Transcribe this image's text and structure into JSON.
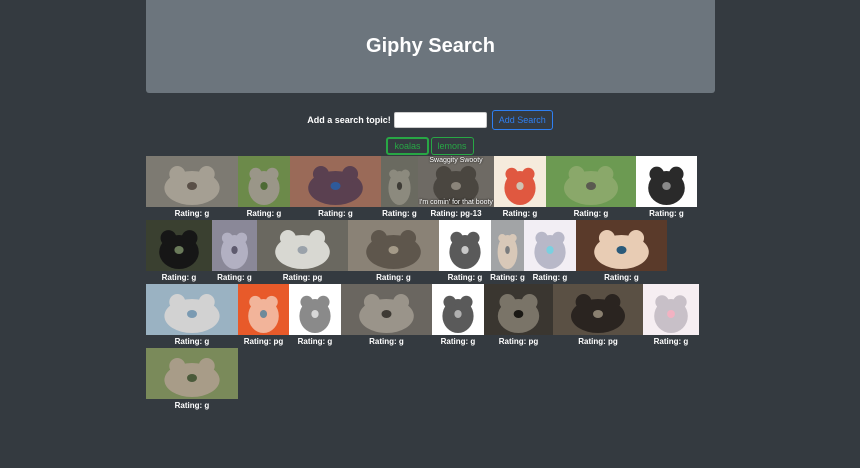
{
  "header": {
    "title": "Giphy Search"
  },
  "search": {
    "label": "Add a search topic!",
    "value": "",
    "placeholder": "",
    "button": "Add Search"
  },
  "topics": [
    {
      "label": "koalas",
      "active": true
    },
    {
      "label": "lemons",
      "active": false
    }
  ],
  "gifs": [
    {
      "rating": "Rating: g",
      "palette": [
        "#7d7a72",
        "#a59f93",
        "#5a5048"
      ],
      "caption": ""
    },
    {
      "rating": "Rating: g",
      "palette": [
        "#6c8a4a",
        "#9a9688",
        "#4d6a34"
      ],
      "caption": ""
    },
    {
      "rating": "Rating: g",
      "palette": [
        "#9a6a58",
        "#5a4050",
        "#2e5a9a"
      ],
      "caption": ""
    },
    {
      "rating": "Rating: g",
      "palette": [
        "#6a6a60",
        "#8c8a7e",
        "#3e3c36"
      ],
      "caption": ""
    },
    {
      "rating": "Rating: pg-13",
      "palette": [
        "#6e6a64",
        "#4a4640",
        "#8a847a"
      ],
      "caption": "Swaggity Swooty",
      "caption2": "I'm comin' for that booty"
    },
    {
      "rating": "Rating: g",
      "palette": [
        "#f5ebdc",
        "#e05840",
        "#cfc3b3"
      ],
      "caption": ""
    },
    {
      "rating": "Rating: g",
      "palette": [
        "#6c9a52",
        "#8aa86a",
        "#5a5a50"
      ],
      "caption": ""
    },
    {
      "rating": "Rating: g",
      "palette": [
        "#ffffff",
        "#2a2a2a",
        "#8a8a8a"
      ],
      "caption": ""
    },
    {
      "rating": "Rating: g",
      "palette": [
        "#3a4030",
        "#161616",
        "#6a7a5a"
      ],
      "caption": ""
    },
    {
      "rating": "Rating: g",
      "palette": [
        "#8a8898",
        "#b2b0c2",
        "#5e5a6e"
      ],
      "caption": ""
    },
    {
      "rating": "Rating: pg",
      "palette": [
        "#6a6860",
        "#d8d8d2",
        "#9aa2aa"
      ],
      "caption": ""
    },
    {
      "rating": "Rating: g",
      "palette": [
        "#8a8276",
        "#5e564c",
        "#a49a88"
      ],
      "caption": ""
    },
    {
      "rating": "Rating: g",
      "palette": [
        "#ffffff",
        "#5a5a5a",
        "#c8c8c8"
      ],
      "caption": ""
    },
    {
      "rating": "Rating: g",
      "palette": [
        "#a2a4a6",
        "#d8c8b8",
        "#7a7c7e"
      ],
      "caption": ""
    },
    {
      "rating": "Rating: g",
      "palette": [
        "#f2eef4",
        "#b8b8c8",
        "#7ad0e0"
      ],
      "caption": ""
    },
    {
      "rating": "Rating: g",
      "palette": [
        "#5a3a2a",
        "#e8ccb4",
        "#2a5a7a"
      ],
      "caption": ""
    },
    {
      "rating": "Rating: g",
      "palette": [
        "#9ab2c2",
        "#d2d2d2",
        "#7a9ab2"
      ],
      "caption": ""
    },
    {
      "rating": "Rating: pg",
      "palette": [
        "#e85a2a",
        "#f2b49a",
        "#6e8a9a"
      ],
      "caption": ""
    },
    {
      "rating": "Rating: g",
      "palette": [
        "#ffffff",
        "#8a8a8a",
        "#d8d8d8"
      ],
      "caption": ""
    },
    {
      "rating": "Rating: g",
      "palette": [
        "#6a6660",
        "#9a948a",
        "#3e3a34"
      ],
      "caption": ""
    },
    {
      "rating": "Rating: g",
      "palette": [
        "#ffffff",
        "#5a5a5a",
        "#b0b0b0"
      ],
      "caption": ""
    },
    {
      "rating": "Rating: pg",
      "palette": [
        "#3a3630",
        "#7a7468",
        "#1a1814"
      ],
      "caption": ""
    },
    {
      "rating": "Rating: pg",
      "palette": [
        "#5a5044",
        "#2a2420",
        "#8a8070"
      ],
      "caption": ""
    },
    {
      "rating": "Rating: g",
      "palette": [
        "#f6eef2",
        "#c8c0c8",
        "#f2b2c2"
      ],
      "caption": ""
    },
    {
      "rating": "Rating: g",
      "palette": [
        "#7a8a5a",
        "#a89c88",
        "#4a5a3a"
      ],
      "caption": ""
    }
  ]
}
